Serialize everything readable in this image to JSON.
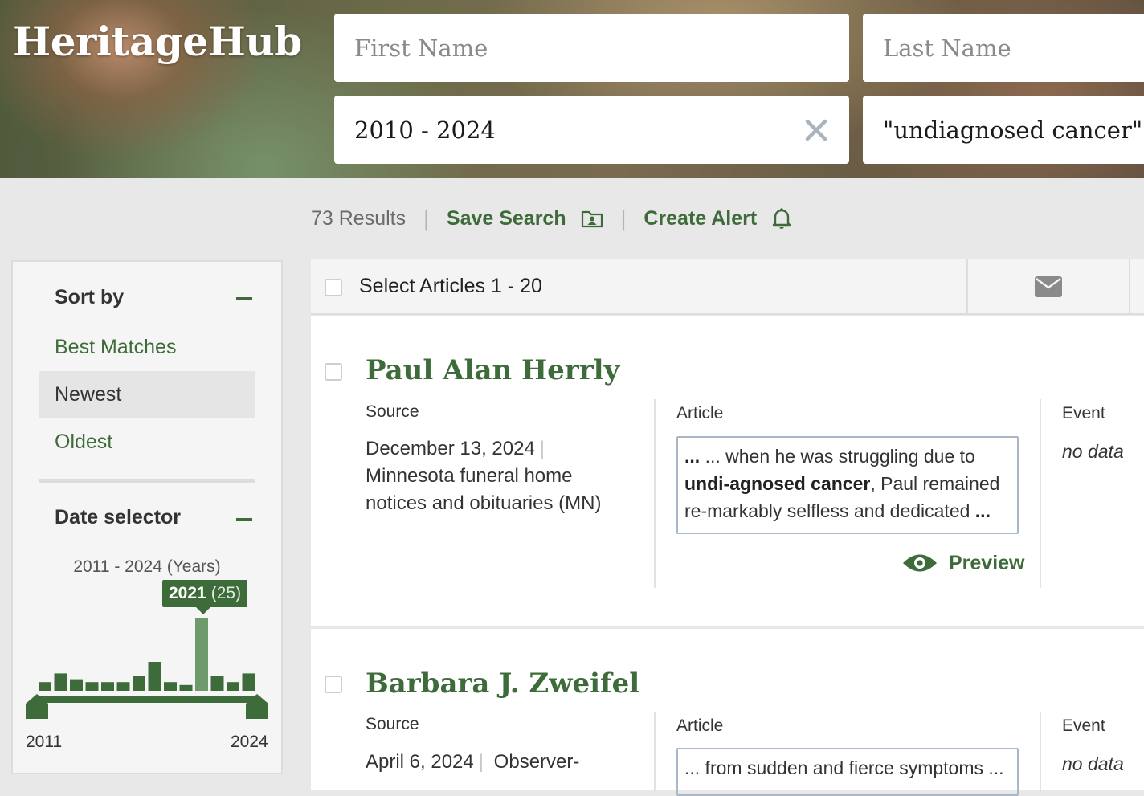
{
  "app": {
    "logo": "HeritageHub"
  },
  "search": {
    "first_name": {
      "placeholder": "First Name",
      "value": ""
    },
    "last_name": {
      "placeholder": "Last Name",
      "value": ""
    },
    "date_range": {
      "value": "2010 - 2024"
    },
    "keywords": {
      "value": "\"undiagnosed cancer\""
    }
  },
  "results_bar": {
    "count": "73 Results",
    "sep": "|",
    "save_search": "Save Search",
    "create_alert": "Create Alert"
  },
  "sidebar": {
    "sort_heading": "Sort by",
    "sort_options": [
      "Best Matches",
      "Newest",
      "Oldest"
    ],
    "sort_selected": "Newest",
    "date_heading": "Date selector",
    "date_range_label": "2011 - 2024 (Years)",
    "tooltip_year": "2021",
    "tooltip_count": "(25)",
    "histogram": {
      "years": [
        2011,
        2012,
        2013,
        2014,
        2015,
        2016,
        2017,
        2018,
        2019,
        2020,
        2021,
        2022,
        2023,
        2024
      ],
      "counts": [
        3,
        6,
        4,
        3,
        3,
        3,
        5,
        10,
        3,
        2,
        25,
        5,
        3,
        6
      ],
      "highlighted": 2021
    },
    "slider_min": "2011",
    "slider_max": "2024"
  },
  "list": {
    "select_label": "Select Articles 1 - 20",
    "articles": [
      {
        "title": "Paul Alan Herrly",
        "source_label": "Source",
        "date": "December 13, 2024",
        "source_name": "Minnesota funeral home notices and obituaries (MN)",
        "article_label": "Article",
        "snippet_pre": "... when he was struggling due to ",
        "snippet_bold": "undi-agnosed cancer",
        "snippet_post": ", Paul remained re-markably selfless and dedicated ",
        "snippet_end": "...",
        "preview": "Preview",
        "event_label": "Event",
        "event_value": "no data"
      },
      {
        "title": "Barbara J. Zweifel",
        "source_label": "Source",
        "date": "April 6, 2024",
        "source_name": "Observer-",
        "article_label": "Article",
        "snippet": "... from sudden and fierce symptoms ...",
        "event_label": "Event",
        "event_value": "no data"
      }
    ]
  },
  "colors": {
    "accent": "#3e6b3a",
    "panel": "#f5f5f5",
    "page_bg": "#e8e8e8"
  }
}
